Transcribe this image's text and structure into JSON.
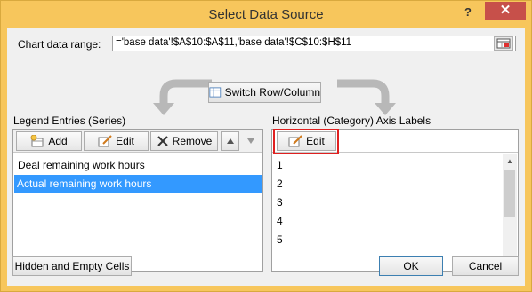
{
  "window": {
    "title": "Select Data Source",
    "help_label": "?",
    "close_label": "✕"
  },
  "range": {
    "label": "Chart data range:",
    "value": "='base data'!$A$10:$A$11,'base data'!$C$10:$H$11"
  },
  "switch_button": {
    "label": "Switch Row/Column"
  },
  "legend": {
    "title": "Legend Entries (Series)",
    "add_label": "Add",
    "edit_label": "Edit",
    "remove_label": "Remove",
    "items": [
      {
        "label": "Deal remaining work hours",
        "selected": false
      },
      {
        "label": "Actual remaining work hours",
        "selected": true
      }
    ]
  },
  "axis": {
    "title": "Horizontal (Category) Axis Labels",
    "edit_label": "Edit",
    "items": [
      "1",
      "2",
      "3",
      "4",
      "5"
    ]
  },
  "footer": {
    "hidden_cells_label": "Hidden and Empty Cells",
    "ok_label": "OK",
    "cancel_label": "Cancel"
  },
  "colors": {
    "frame": "#f7c65c",
    "selection": "#3399ff",
    "highlight": "#e02020"
  }
}
